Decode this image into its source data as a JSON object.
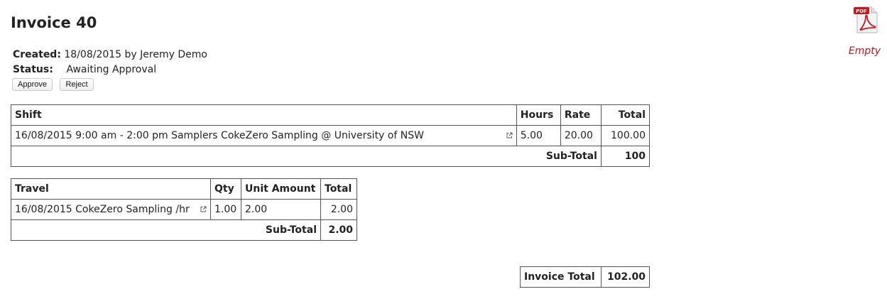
{
  "invoice": {
    "title": "Invoice 40",
    "created_label": "Created:",
    "created_value": "18/08/2015 by Jeremy Demo",
    "status_label": "Status:",
    "status_value": "Awaiting Approval",
    "approve_label": "Approve",
    "reject_label": "Reject"
  },
  "attachment": {
    "icon": "pdf-file-icon",
    "badge_text": "PDF",
    "empty_text": "Empty"
  },
  "shifts": {
    "headers": [
      "Shift",
      "Hours",
      "Rate",
      "Total"
    ],
    "rows": [
      {
        "shift": "16/08/2015 9:00 am - 2:00 pm Samplers CokeZero Sampling @ University of NSW",
        "hours": "5.00",
        "rate": "20.00",
        "total": "100.00"
      }
    ],
    "subtotal_label": "Sub-Total",
    "subtotal_value": "100"
  },
  "travel": {
    "headers": [
      "Travel",
      "Qty",
      "Unit Amount",
      "Total"
    ],
    "rows": [
      {
        "travel": "16/08/2015 CokeZero Sampling /hr",
        "qty": "1.00",
        "unit_amount": "2.00",
        "total": "2.00"
      }
    ],
    "subtotal_label": "Sub-Total",
    "subtotal_value": "2.00"
  },
  "totals": {
    "invoice_total_label": "Invoice Total",
    "invoice_total_value": "102.00"
  },
  "colors": {
    "empty_text": "#c0141b",
    "pdf_red": "#c8161d"
  }
}
